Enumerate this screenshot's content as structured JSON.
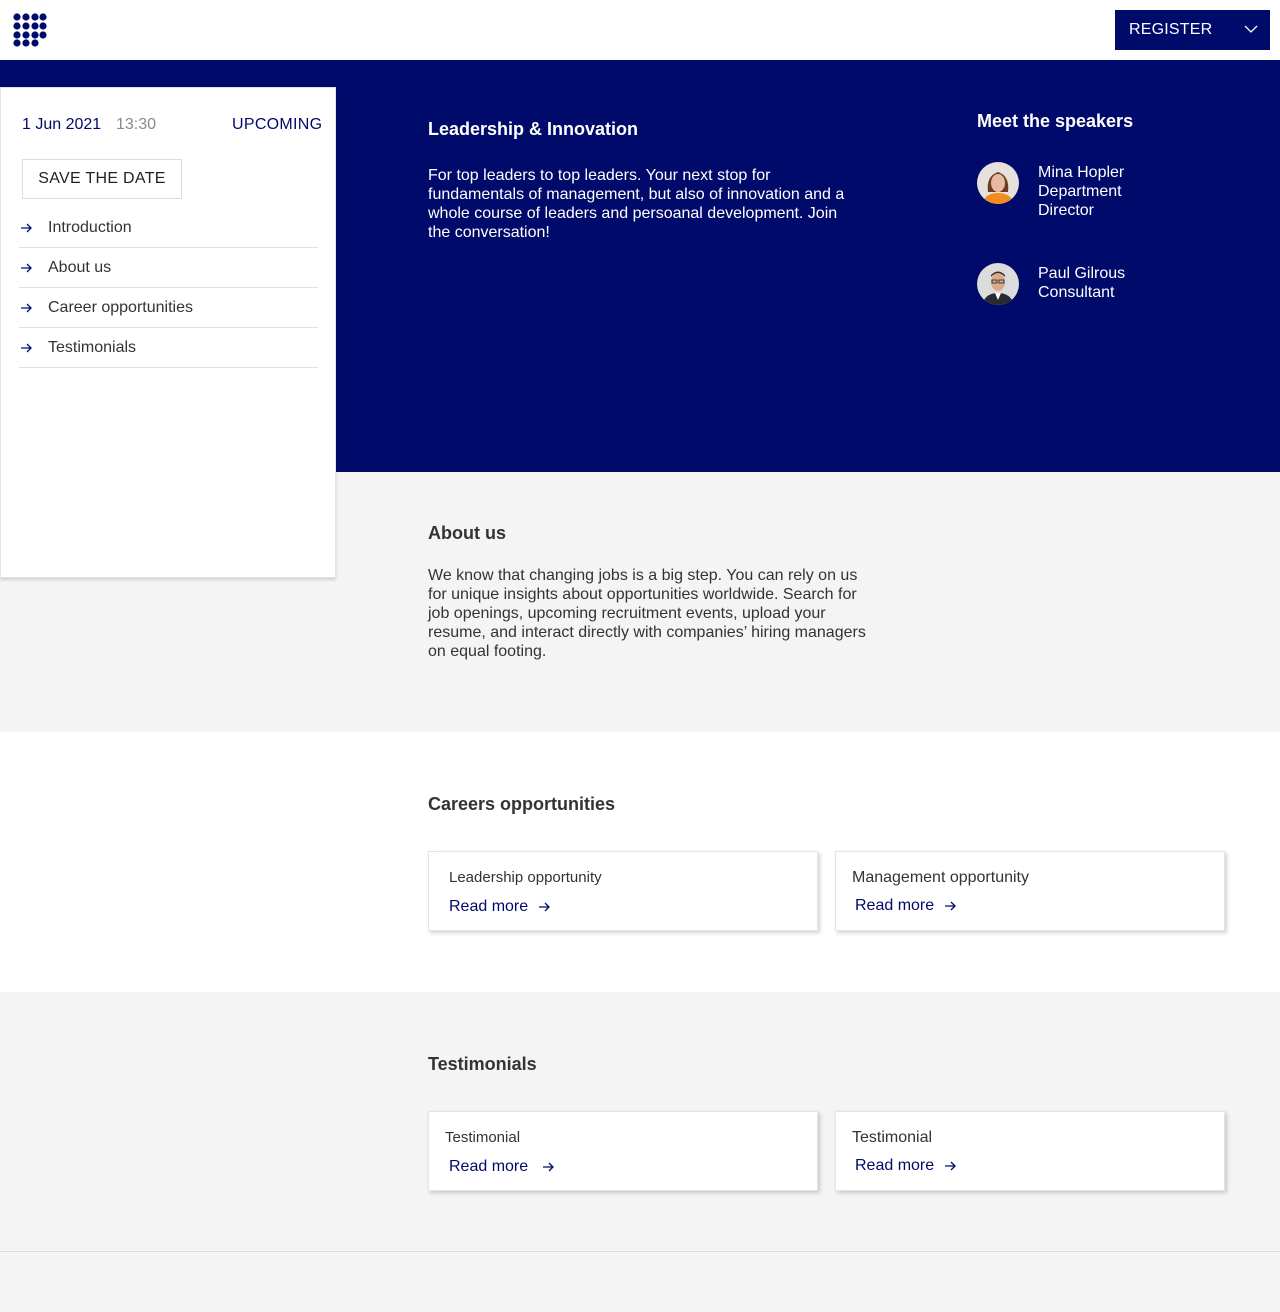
{
  "header": {
    "register_label": "REGISTER"
  },
  "event": {
    "date": "1 Jun 2021",
    "time": "13:30",
    "status": "UPCOMING",
    "save_label": "SAVE THE DATE",
    "nav": [
      "Introduction",
      "About us",
      "Career opportunities",
      "Testimonials"
    ]
  },
  "hero": {
    "title": "Leadership & Innovation",
    "text": "For top leaders to top leaders. Your next stop for fundamentals of management, but also of innovation and a whole course of leaders and persoanal development. Join the conversation!",
    "speakers_title": "Meet the speakers",
    "speakers": [
      {
        "name": "Mina Hopler",
        "role": "Department Director"
      },
      {
        "name": "Paul Gilrous",
        "role": "Consultant"
      }
    ]
  },
  "about": {
    "title": "About us",
    "text": "We know that changing jobs is a big step. You can rely on us for unique insights about opportunities worldwide. Search for job openings, upcoming recruitment events, upload your resume, and interact directly with companies’ hiring managers on equal footing."
  },
  "careers": {
    "title": "Careers opportunities",
    "cards": [
      {
        "title": "Leadership opportunity",
        "link": "Read more"
      },
      {
        "title": "Management opportunity",
        "link": "Read more"
      }
    ]
  },
  "testimonials": {
    "title": "Testimonials",
    "cards": [
      {
        "title": "Testimonial",
        "link": "Read more"
      },
      {
        "title": "Testimonial",
        "link": "Read more"
      }
    ]
  },
  "colors": {
    "brand": "#000a6a",
    "background": "#f4f4f4",
    "text": "#333333"
  }
}
